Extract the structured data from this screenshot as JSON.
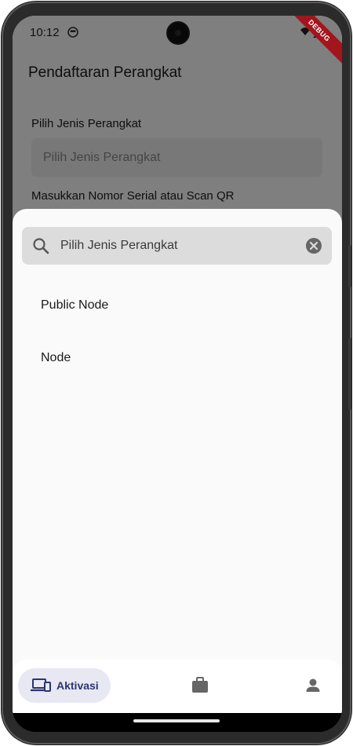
{
  "status_bar": {
    "time": "10:12",
    "debug_label": "DEBUG"
  },
  "page": {
    "title": "Pendaftaran Perangkat",
    "device_type_label": "Pilih Jenis Perangkat",
    "device_type_placeholder": "Pilih Jenis Perangkat",
    "serial_label": "Masukkan Nomor Serial atau Scan QR"
  },
  "sheet": {
    "search_text": "Pilih Jenis Perangkat",
    "options": [
      {
        "label": "Public Node"
      },
      {
        "label": "Node"
      }
    ]
  },
  "bottom_nav": {
    "items": [
      {
        "label": "Aktivasi",
        "icon": "devices-icon",
        "active": true
      },
      {
        "label": "",
        "icon": "briefcase-icon",
        "active": false
      },
      {
        "label": "",
        "icon": "person-icon",
        "active": false
      }
    ]
  },
  "colors": {
    "accent": "#2b3470",
    "nav_active_bg": "#e7e8f2",
    "debug_banner": "#a3151c",
    "search_bg": "#dcdcdc"
  }
}
